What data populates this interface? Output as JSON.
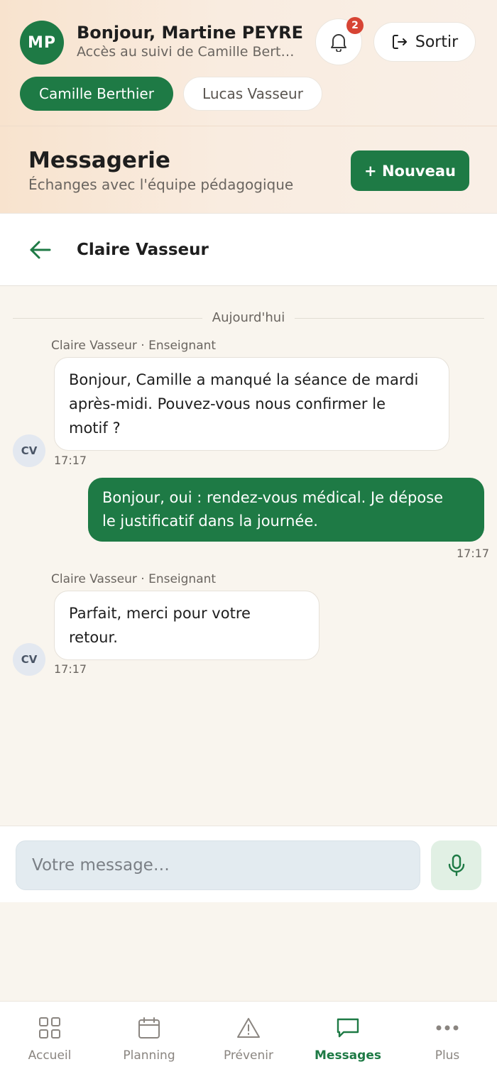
{
  "header": {
    "avatar_initials": "MP",
    "greeting": "Bonjour, Martine PEYRE",
    "access_text": "Accès au suivi de Camille Berthier",
    "notification_count": "2",
    "logout_label": "Sortir"
  },
  "students": [
    {
      "name": "Camille Berthier",
      "active": true
    },
    {
      "name": "Lucas Vasseur",
      "active": false
    }
  ],
  "page": {
    "title": "Messagerie",
    "subtitle": "Échanges avec l'équipe pédagogique",
    "new_button": "+ Nouveau"
  },
  "conversation": {
    "contact_name": "Claire Vasseur",
    "date_divider": "Aujourd'hui",
    "messages": [
      {
        "direction": "in",
        "sender": "Claire Vasseur · Enseignant",
        "avatar": "CV",
        "lines": [
          "Bonjour, Camille a manqué la séance de mardi",
          "après-midi. Pouvez-vous nous confirmer le",
          "motif ?"
        ],
        "time": "17:17"
      },
      {
        "direction": "out",
        "lines": [
          "Bonjour, oui : rendez-vous médical. Je dépose",
          "le justificatif dans la journée."
        ],
        "time": "17:17"
      },
      {
        "direction": "in",
        "sender": "Claire Vasseur · Enseignant",
        "avatar": "CV",
        "lines": [
          "Parfait, merci pour votre",
          "retour."
        ],
        "time": "17:17"
      }
    ]
  },
  "composer": {
    "placeholder": "Votre message…"
  },
  "nav": [
    {
      "label": "Accueil",
      "icon": "grid-icon",
      "active": false
    },
    {
      "label": "Planning",
      "icon": "calendar-icon",
      "active": false
    },
    {
      "label": "Prévenir",
      "icon": "warning-icon",
      "active": false
    },
    {
      "label": "Messages",
      "icon": "chat-icon",
      "active": true
    },
    {
      "label": "Plus",
      "icon": "more-icon",
      "active": false
    }
  ],
  "colors": {
    "primary": "#1e7a45",
    "badge": "#d74434",
    "muted": "#8a8580"
  }
}
